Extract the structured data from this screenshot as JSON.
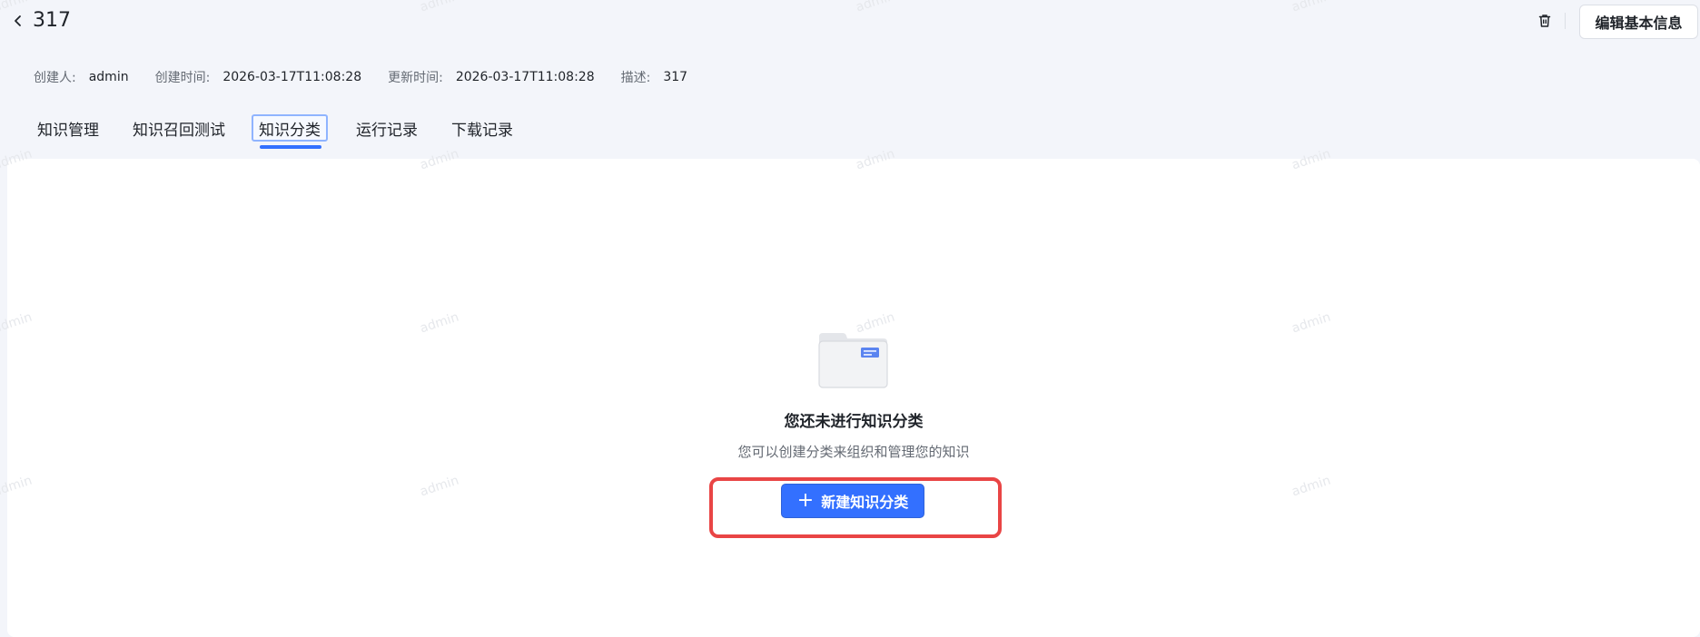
{
  "header": {
    "title": "317",
    "edit_label": "编辑基本信息"
  },
  "meta": {
    "creator_label": "创建人:",
    "creator": "admin",
    "created_label": "创建时间:",
    "created": "2026-03-17T11:08:28",
    "updated_label": "更新时间:",
    "updated": "2026-03-17T11:08:28",
    "desc_label": "描述:",
    "desc": "317"
  },
  "tabs": [
    {
      "label": "知识管理"
    },
    {
      "label": "知识召回测试"
    },
    {
      "label": "知识分类",
      "active": true
    },
    {
      "label": "运行记录"
    },
    {
      "label": "下载记录"
    }
  ],
  "empty": {
    "title": "您还未进行知识分类",
    "desc": "您可以创建分类来组织和管理您的知识",
    "button_label": "新建知识分类"
  },
  "watermark": "admin",
  "colors": {
    "accent": "#3370ff",
    "highlight": "#e94545"
  }
}
